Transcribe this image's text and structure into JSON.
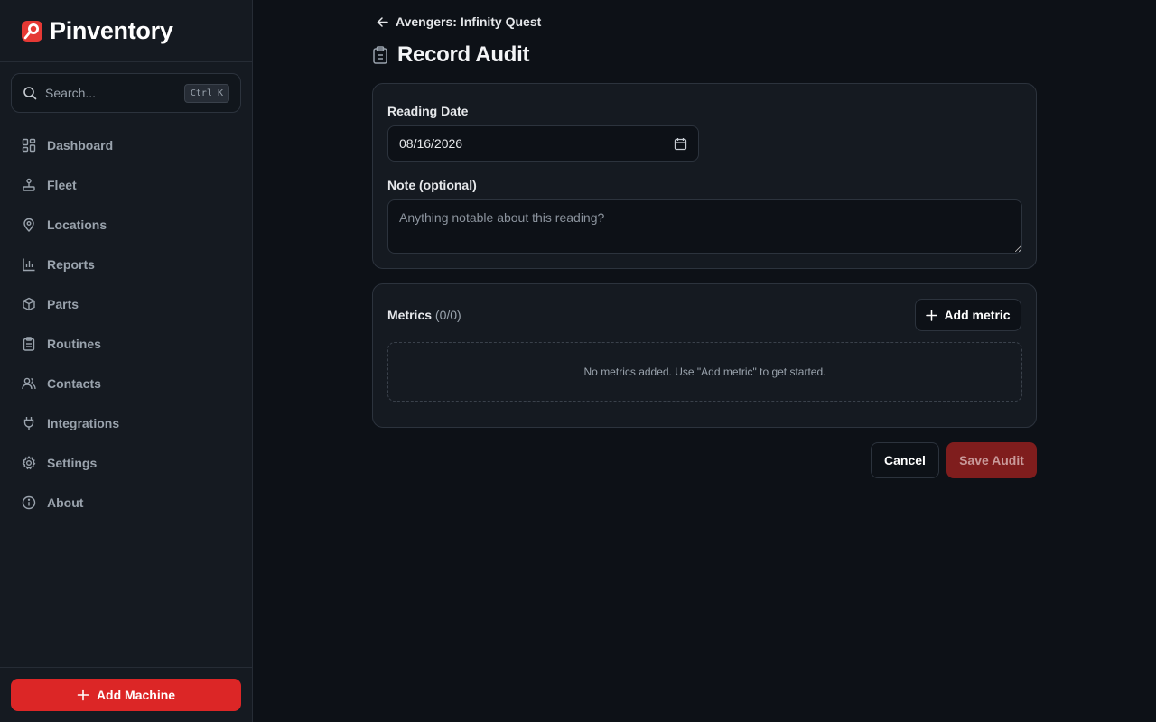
{
  "app": {
    "name": "Pinventory",
    "logo_icon": "pin-logo-icon",
    "accent": "#dc2626"
  },
  "search": {
    "placeholder": "Search...",
    "shortcut": "Ctrl K",
    "icon": "search-icon"
  },
  "sidebar": {
    "items": [
      {
        "label": "Dashboard",
        "icon": "dashboard-icon"
      },
      {
        "label": "Fleet",
        "icon": "joystick-icon"
      },
      {
        "label": "Locations",
        "icon": "map-pin-icon"
      },
      {
        "label": "Reports",
        "icon": "bar-chart-icon"
      },
      {
        "label": "Parts",
        "icon": "package-icon"
      },
      {
        "label": "Routines",
        "icon": "clipboard-list-icon"
      },
      {
        "label": "Contacts",
        "icon": "users-icon"
      },
      {
        "label": "Integrations",
        "icon": "plug-icon"
      },
      {
        "label": "Settings",
        "icon": "gear-icon"
      },
      {
        "label": "About",
        "icon": "info-icon"
      }
    ],
    "add_machine_label": "Add Machine"
  },
  "main": {
    "back_label": "Avengers: Infinity Quest",
    "title": "Record Audit",
    "form": {
      "date_label": "Reading Date",
      "date_value": "08/16/2026",
      "note_label": "Note (optional)",
      "note_placeholder": "Anything notable about this reading?",
      "note_value": ""
    },
    "metrics": {
      "title": "Metrics",
      "count": "(0/0)",
      "add_label": "Add metric",
      "empty_text": "No metrics added. Use \"Add metric\" to get started."
    },
    "actions": {
      "cancel_label": "Cancel",
      "save_label": "Save Audit"
    }
  }
}
